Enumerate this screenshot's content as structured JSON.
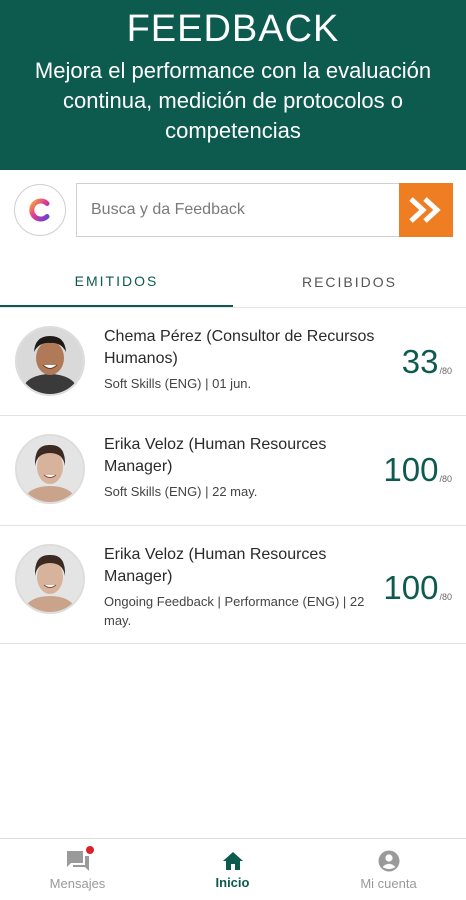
{
  "header": {
    "title": "FEEDBACK",
    "subtitle": "Mejora el performance con la evaluación continua, medición de protocolos o competencias"
  },
  "search": {
    "placeholder": "Busca y da Feedback",
    "button_icon": "double-chevron-right-icon",
    "logo_letter": "C"
  },
  "tabs": [
    {
      "label": "EMITIDOS",
      "active": true
    },
    {
      "label": "RECIBIDOS",
      "active": false
    }
  ],
  "feedback_items": [
    {
      "name": "Chema Pérez (Consultor de Recursos Humanos)",
      "meta": "Soft Skills  (ENG) | 01 jun.",
      "score": "33",
      "max": "/80"
    },
    {
      "name": "Erika Veloz (Human Resources Manager)",
      "meta": "Soft Skills  (ENG) | 22 may.",
      "score": "100",
      "max": "/80"
    },
    {
      "name": "Erika Veloz (Human Resources Manager)",
      "meta": "Ongoing Feedback | Performance (ENG) | 22 may.",
      "score": "100",
      "max": "/80"
    }
  ],
  "bottom_nav": [
    {
      "label": "Mensajes",
      "icon": "chat-icon",
      "active": false,
      "has_badge": true
    },
    {
      "label": "Inicio",
      "icon": "home-icon",
      "active": true
    },
    {
      "label": "Mi cuenta",
      "icon": "account-icon",
      "active": false
    }
  ],
  "colors": {
    "primary": "#0d5a4f",
    "accent": "#ef7d22",
    "badge": "#d9242a"
  }
}
